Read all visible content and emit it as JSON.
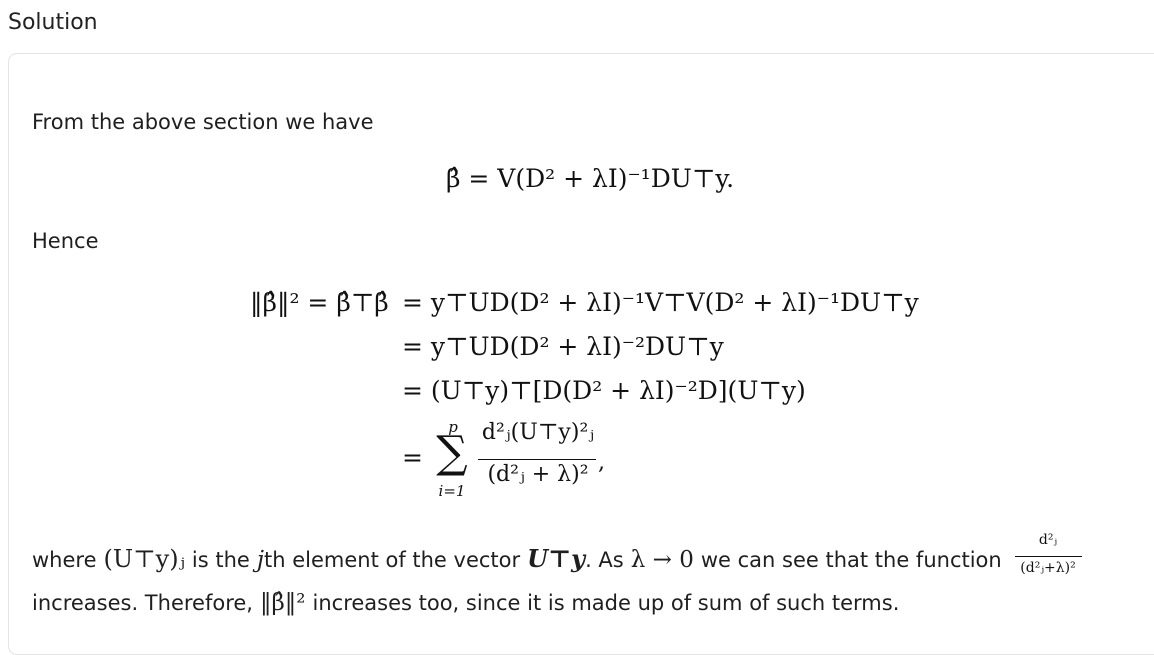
{
  "heading": "Solution",
  "intro": "From the above section we have",
  "eq1": "β̂ = V(D² + λI)⁻¹DU⊤y.",
  "hence": "Hence",
  "eq2_lhs": "‖β̂‖² = β̂⊤β̂",
  "eq2_lines": [
    "= y⊤UD(D² + λI)⁻¹V⊤V(D² + λI)⁻¹DU⊤y",
    "= y⊤UD(D² + λI)⁻²DU⊤y",
    "= (U⊤y)⊤[D(D² + λI)⁻²D](U⊤y)"
  ],
  "eq2_sum": {
    "eq": "=",
    "upper": "p",
    "sigma": "∑",
    "lower": "i=1",
    "numerator": "d²ⱼ(U⊤y)²ⱼ",
    "denominator": "(d²ⱼ + λ)²",
    "trail": ","
  },
  "closing": {
    "where": "where",
    "uty_j": "(U⊤y)ⱼ",
    "is_the": "is the",
    "j": "j",
    "jth_rest": "th element of the vector",
    "uty": "U⊤y",
    "as": ". As",
    "lambda_to_zero": "λ → 0",
    "see": "we can see that the function",
    "f_num": "d²ⱼ",
    "f_den": "(d²ⱼ+λ)²",
    "line2_a": "increases. Therefore,",
    "norm": "‖β̂‖²",
    "line2_b": "increases too, since it is made up of sum of such terms."
  }
}
